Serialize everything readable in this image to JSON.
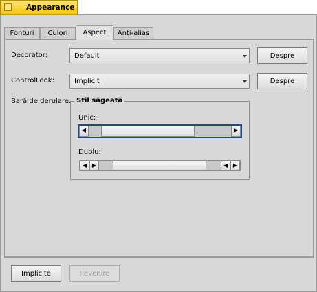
{
  "window": {
    "title": "Appearance"
  },
  "tabs": [
    {
      "label": "Fonturi"
    },
    {
      "label": "Culori"
    },
    {
      "label": "Aspect"
    },
    {
      "label": "Anti-alias"
    }
  ],
  "decorator": {
    "label": "Decorator:",
    "value": "Default",
    "about_label": "Despre"
  },
  "controllook": {
    "label": "ControlLook:",
    "value": "Implicit",
    "about_label": "Despre"
  },
  "scrollbar": {
    "label": "Bară de derulare:",
    "group_title": "Stil săgeată",
    "single_label": "Unic:",
    "double_label": "Dublu:"
  },
  "footer": {
    "defaults_label": "Implicite",
    "revert_label": "Revenire"
  },
  "colors": {
    "title_tab": "#f5c400",
    "panel": "#d8d8d8",
    "focus": "#1f4a8a"
  }
}
